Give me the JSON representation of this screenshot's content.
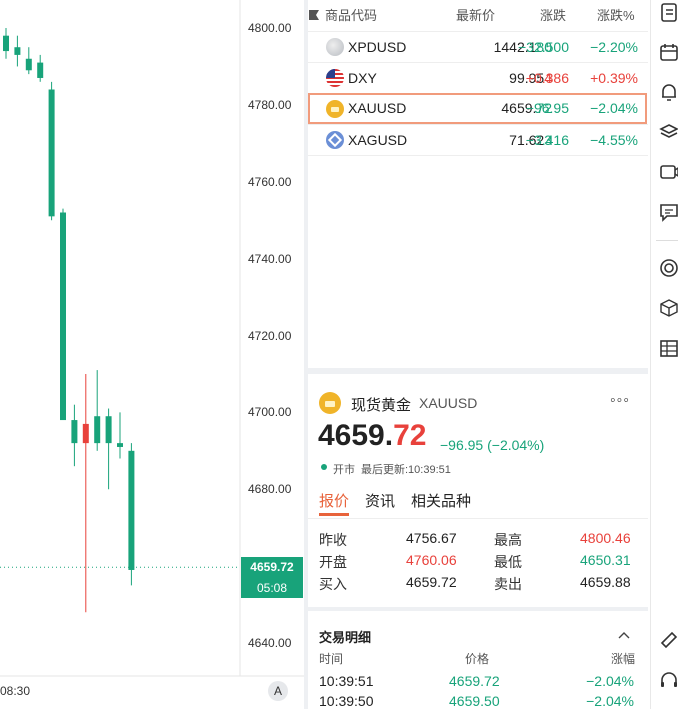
{
  "chart": {
    "y_ticks": [
      "4800.00",
      "4780.00",
      "4760.00",
      "4740.00",
      "4720.00",
      "4700.00",
      "4680.00",
      "4640.00"
    ],
    "current_price": "4659.72",
    "countdown": "05:08",
    "x_tick": "08:30",
    "auto_button": "A",
    "up_color": "#e8413b",
    "down_color": "#18a37a",
    "candles": [
      {
        "o": 4798,
        "c": 4794,
        "h": 4800,
        "l": 4792
      },
      {
        "o": 4795,
        "c": 4793,
        "h": 4798,
        "l": 4790
      },
      {
        "o": 4792,
        "c": 4789,
        "h": 4795,
        "l": 4788
      },
      {
        "o": 4791,
        "c": 4787,
        "h": 4793,
        "l": 4786
      },
      {
        "o": 4784,
        "c": 4751,
        "h": 4786,
        "l": 4750
      },
      {
        "o": 4752,
        "c": 4698,
        "h": 4753,
        "l": 4725
      },
      {
        "o": 4698,
        "c": 4692,
        "h": 4702,
        "l": 4686
      },
      {
        "o": 4692,
        "c": 4697,
        "h": 4710,
        "l": 4648
      },
      {
        "o": 4699,
        "c": 4692,
        "h": 4711,
        "l": 4690
      },
      {
        "o": 4699,
        "c": 4692,
        "h": 4701,
        "l": 4680
      },
      {
        "o": 4692,
        "c": 4691,
        "h": 4700,
        "l": 4688
      },
      {
        "o": 4690,
        "c": 4659,
        "h": 4692,
        "l": 4655
      }
    ]
  },
  "watchlist": {
    "headers": {
      "code": "商品代码",
      "last": "最新价",
      "change": "涨跌",
      "pct": "涨跌%"
    },
    "rows": [
      {
        "code": "XPDUSD",
        "last_main": "1442.1",
        "last_tail": "80",
        "change": "−32.500",
        "pct": "−2.20%",
        "dir": "down",
        "icon": "palladium-icon",
        "icon_color": "#b8bcc2"
      },
      {
        "code": "DXY",
        "last_main": "99.95",
        "last_tail": "4",
        "change": "+0.386",
        "pct": "+0.39%",
        "dir": "up",
        "icon": "us-flag-icon",
        "icon_color": "#2b3f8c"
      },
      {
        "code": "XAUUSD",
        "last_main": "4659.",
        "last_tail": "72",
        "change": "−96.95",
        "pct": "−2.04%",
        "dir": "down",
        "icon": "gold-icon",
        "icon_color": "#f0b429"
      },
      {
        "code": "XAGUSD",
        "last_main": "71.62",
        "last_tail": "3",
        "change": "−3.416",
        "pct": "−4.55%",
        "dir": "down",
        "icon": "silver-icon",
        "icon_color": "#6b8fd6"
      }
    ]
  },
  "detail": {
    "name": "现货黄金",
    "code": "XAUUSD",
    "price_main": "4659.",
    "price_tail": "72",
    "change": "−96.95 (−2.04%)",
    "status": "开市",
    "updated": "最后更新:10:39:51",
    "tabs": [
      "报价",
      "资讯",
      "相关品种"
    ],
    "quotes": {
      "prev_close_label": "昨收",
      "prev_close": "4756.67",
      "high_label": "最高",
      "high": "4800.46",
      "open_label": "开盘",
      "open": "4760.06",
      "low_label": "最低",
      "low": "4650.31",
      "bid_label": "买入",
      "bid": "4659.72",
      "ask_label": "卖出",
      "ask": "4659.88"
    }
  },
  "trades": {
    "title": "交易明细",
    "headers": {
      "time": "时间",
      "price": "价格",
      "pct": "涨幅"
    },
    "rows": [
      {
        "time": "10:39:51",
        "price": "4659.72",
        "pct": "−2.04%"
      },
      {
        "time": "10:39:50",
        "price": "4659.50",
        "pct": "−2.04%"
      }
    ]
  }
}
